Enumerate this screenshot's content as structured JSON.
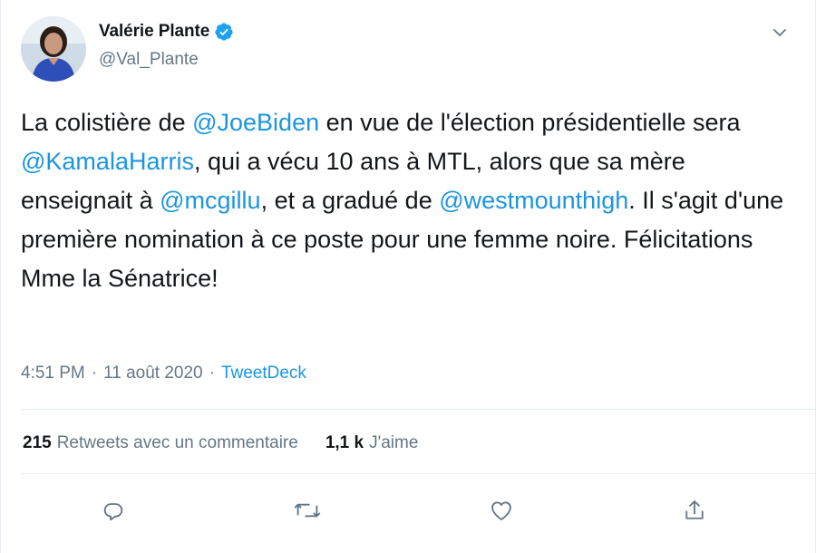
{
  "tweet": {
    "display_name": "Valérie Plante",
    "handle": "@Val_Plante",
    "segments": [
      {
        "t": "La colistière de ",
        "m": false
      },
      {
        "t": "@JoeBiden",
        "m": true
      },
      {
        "t": " en vue de l'élection présidentielle sera ",
        "m": false
      },
      {
        "t": "@KamalaHarris",
        "m": true
      },
      {
        "t": ", qui a vécu 10 ans à MTL, alors que sa mère enseignait à ",
        "m": false
      },
      {
        "t": "@mcgillu",
        "m": true
      },
      {
        "t": ", et a gradué de ",
        "m": false
      },
      {
        "t": "@westmounthigh",
        "m": true
      },
      {
        "t": ". Il s'agit d'une première nomination à ce poste pour une femme noire. Félicitations Mme la Sénatrice!",
        "m": false
      }
    ],
    "time": "4:51 PM",
    "date": "11 août 2020",
    "separator": "·",
    "source": "TweetDeck"
  },
  "stats": {
    "retweets_count": "215",
    "retweets_label": "Retweets avec un commentaire",
    "likes_count": "1,1 k",
    "likes_label": "J'aime"
  },
  "icons": {
    "reply": "reply-icon",
    "retweet": "retweet-icon",
    "like": "heart-icon",
    "share": "share-icon",
    "verified": "verified-badge-icon",
    "menu": "chevron-down-icon"
  },
  "colors": {
    "link": "#1b95e0",
    "secondary": "#657786",
    "text": "#14171a",
    "verified": "#1da1f2",
    "divider": "#e6ecf0"
  }
}
